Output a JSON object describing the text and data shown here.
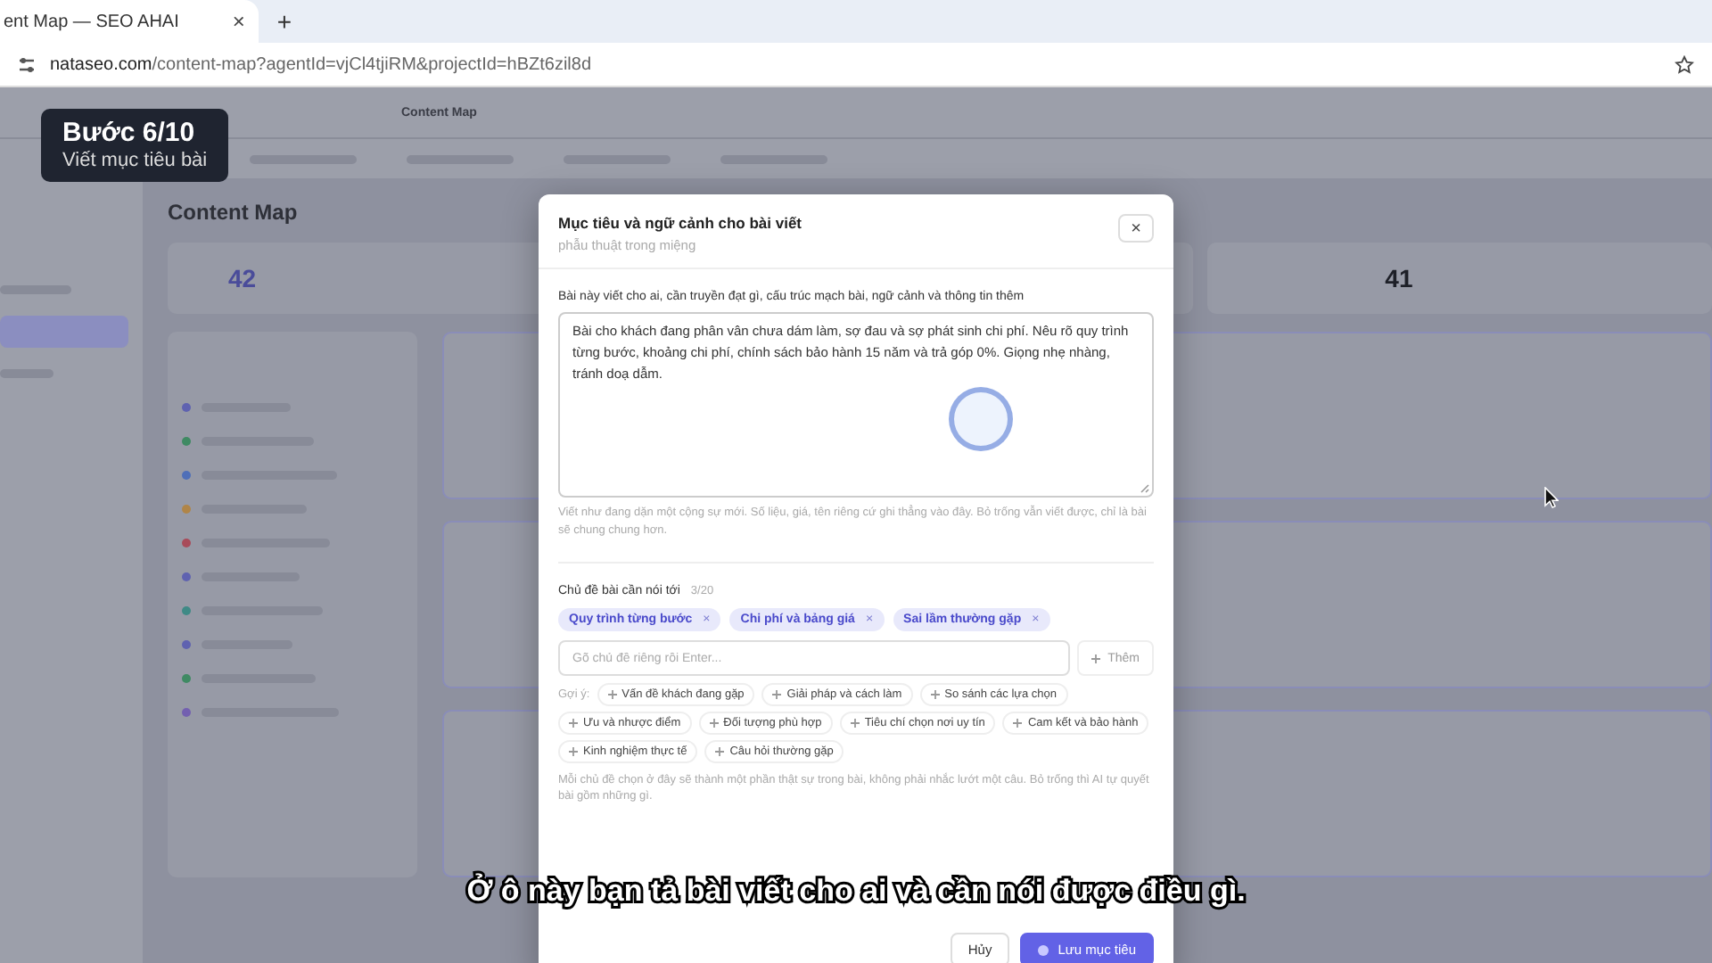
{
  "browser": {
    "tab_title": "ent Map — SEO AHAI",
    "tab_close": "×",
    "new_tab": "+",
    "url_host": "nataseo.com",
    "url_path": "/content-map?agentId=vjCl4tjiRM&projectId=hBZt6zil8d"
  },
  "step_badge": {
    "title": "Bước 6/10",
    "subtitle": "Viết mục tiêu bài"
  },
  "page": {
    "breadcrumb": "Content Map",
    "title": "Content Map",
    "stats": [
      {
        "value": "42"
      },
      {
        "value": "41"
      }
    ],
    "clusters": [
      {
        "color": "#5f62b0"
      },
      {
        "color": "#3f8a63"
      },
      {
        "color": "#4f6fb8"
      },
      {
        "color": "#b08548"
      },
      {
        "color": "#a84b5a"
      },
      {
        "color": "#5f62b0"
      },
      {
        "color": "#3f8a86"
      },
      {
        "color": "#5f62b0"
      },
      {
        "color": "#3f8a63"
      },
      {
        "color": "#7360b0"
      }
    ]
  },
  "modal": {
    "title": "Mục tiêu và ngữ cảnh cho bài viết",
    "subtitle": "phẫu thuật trong miệng",
    "close": "×",
    "field_label": "Bài này viết cho ai, cần truyền đạt gì, cấu trúc mạch bài, ngữ cảnh và thông tin thêm",
    "value": "Bài cho khách đang phân vân chưa dám làm, sợ đau và sợ phát sinh chi phí. Nêu rõ quy trình từng bước, khoảng chi phí, chính sách bảo hành 15 năm và trả góp 0%. Giọng nhẹ nhàng, tránh doạ dẫm.",
    "helper": "Viết như đang dặn một cộng sự mới. Số liệu, giá, tên riêng cứ ghi thẳng vào đây. Bỏ trống vẫn viết được, chỉ là bài sẽ chung chung hơn.",
    "topics_label": "Chủ đề bài cần nói tới",
    "topics_count": "3/20",
    "selected_topics": [
      {
        "label": "Quy trình từng bước",
        "remove": "×"
      },
      {
        "label": "Chi phí và bảng giá",
        "remove": "×"
      },
      {
        "label": "Sai lầm thường gặp",
        "remove": "×"
      }
    ],
    "topic_input": {
      "placeholder": "Gõ chủ đề riêng rồi Enter..."
    },
    "add_button": "Thêm",
    "suggestions_label": "Gợi ý:",
    "suggestions": [
      "Vấn đề khách đang gặp",
      "Giải pháp và cách làm",
      "So sánh các lựa chọn",
      "Ưu và nhược điểm",
      "Đối tượng phù hợp",
      "Tiêu chí chọn nơi uy tín",
      "Cam kết và bảo hành",
      "Kinh nghiệm thực tế",
      "Câu hỏi thường gặp"
    ],
    "hint": "Mỗi chủ đề chọn ở đây sẽ thành một phần thật sự trong bài, không phải nhắc lướt một câu. Bỏ trống thì AI tự quyết bài gồm những gì.",
    "buttons": [
      {
        "kind": "secondary",
        "label": "Hủy"
      },
      {
        "kind": "primary",
        "label": "Lưu mục tiêu"
      }
    ]
  },
  "caption": "Ở ô này bạn tả bài viết cho ai và cần nói được điều gì."
}
